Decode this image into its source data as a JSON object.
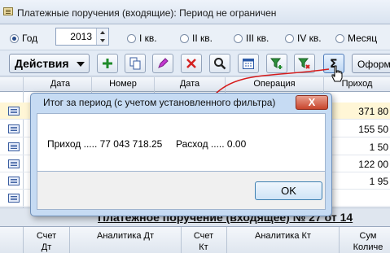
{
  "window": {
    "title": "Платежные поручения (входящие): Период не ограничен"
  },
  "period": {
    "options": [
      {
        "label": "Год",
        "selected": true
      },
      {
        "label": "I кв.",
        "selected": false
      },
      {
        "label": "II кв.",
        "selected": false
      },
      {
        "label": "III кв.",
        "selected": false
      },
      {
        "label": "IV кв.",
        "selected": false
      },
      {
        "label": "Месяц",
        "selected": false
      }
    ],
    "year": "2013"
  },
  "toolbar": {
    "actions_label": "Действия",
    "buttons": [
      "add-icon",
      "copy-icon",
      "edit-icon",
      "delete-icon",
      "search-icon",
      "calendar-icon",
      "filter-add-icon",
      "filter-remove-icon",
      "sum-icon"
    ],
    "print_label": "Оформ"
  },
  "grid": {
    "columns": [
      "Дата",
      "Номер",
      "Дата",
      "Операция",
      "Приход"
    ],
    "rows": [
      {
        "amount": "371 80",
        "selected": true
      },
      {
        "amount": "155 50",
        "selected": false
      },
      {
        "amount": "1 50",
        "selected": false
      },
      {
        "amount": "122 00",
        "selected": false
      },
      {
        "amount": "1 95",
        "selected": false
      },
      {
        "amount": "",
        "selected": false
      }
    ]
  },
  "document": {
    "title": "Платежное поручение (входящее) № 27 от 14"
  },
  "bottom_grid": {
    "columns": [
      "Счет Дт",
      "Аналитика Дт",
      "Счет Кт",
      "Аналитика Кт",
      "Сум Количе"
    ]
  },
  "dialog": {
    "title": "Итог за период (с учетом установленного фильтра)",
    "close": "X",
    "message": "Приход ..... 77 043 718.25     Расход ..... 0.00",
    "ok": "OK"
  },
  "colors": {
    "accent": "#4a78b8",
    "arrow": "#d61c1c",
    "close": "#c8452d"
  }
}
